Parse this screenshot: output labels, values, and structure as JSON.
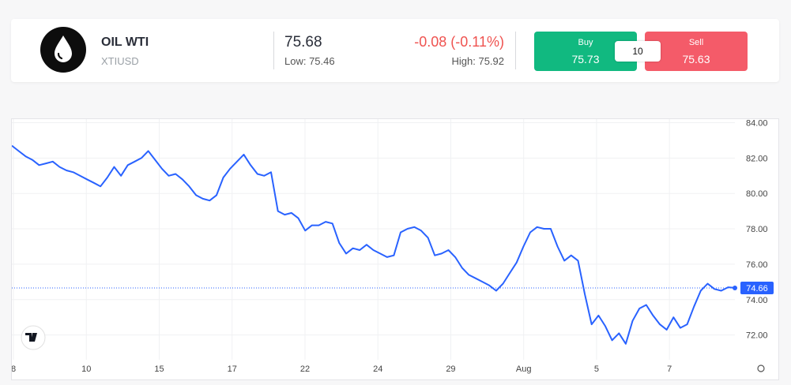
{
  "instrument": {
    "name": "OIL WTI",
    "symbol": "XTIUSD",
    "price": "75.68",
    "low_text": "Low: 75.46",
    "change_text": "-0.08 (-0.11%)",
    "high_text": "High: 75.92",
    "logo_icon": "oil-drop-icon"
  },
  "trade": {
    "buy_label": "Buy",
    "buy_price": "75.73",
    "sell_label": "Sell",
    "sell_price": "75.63",
    "quantity": "10"
  },
  "colors": {
    "buy": "#11b980",
    "sell": "#f45b69",
    "line": "#2962ff",
    "change_negative": "#ef5350"
  },
  "chart_data": {
    "type": "line",
    "title": "",
    "xlabel": "",
    "ylabel": "",
    "ylim": [
      70.6,
      84.2
    ],
    "x_ticks": [
      "8",
      "10",
      "15",
      "17",
      "22",
      "24",
      "29",
      "Aug",
      "5",
      "7"
    ],
    "y_ticks": [
      "84.00",
      "82.00",
      "80.00",
      "78.00",
      "76.00",
      "74.00",
      "72.00"
    ],
    "y_tick_values": [
      84,
      82,
      80,
      78,
      76,
      74,
      72
    ],
    "current_value": 74.66,
    "current_label": "74.66",
    "grid": true,
    "series": [
      {
        "name": "",
        "values": [
          82.7,
          82.4,
          82.1,
          81.9,
          81.6,
          81.7,
          81.8,
          81.5,
          81.3,
          81.2,
          81.0,
          80.8,
          80.6,
          80.4,
          80.9,
          81.5,
          81.0,
          81.6,
          81.8,
          82.0,
          82.4,
          81.9,
          81.4,
          81.0,
          81.1,
          80.8,
          80.4,
          79.9,
          79.7,
          79.6,
          79.9,
          80.9,
          81.4,
          81.8,
          82.2,
          81.6,
          81.1,
          81.0,
          81.2,
          79.0,
          78.8,
          78.9,
          78.6,
          77.9,
          78.2,
          78.2,
          78.4,
          78.3,
          77.2,
          76.6,
          76.9,
          76.8,
          77.1,
          76.8,
          76.6,
          76.4,
          76.5,
          77.8,
          78.0,
          78.1,
          77.9,
          77.5,
          76.5,
          76.6,
          76.8,
          76.4,
          75.8,
          75.4,
          75.2,
          75.0,
          74.8,
          74.5,
          74.9,
          75.5,
          76.1,
          77.0,
          77.8,
          78.1,
          78.0,
          78.0,
          77.0,
          76.2,
          76.5,
          76.2,
          74.3,
          72.6,
          73.1,
          72.5,
          71.7,
          72.1,
          71.5,
          72.8,
          73.5,
          73.7,
          73.1,
          72.6,
          72.3,
          73.0,
          72.4,
          72.6,
          73.6,
          74.5,
          74.9,
          74.6,
          74.5,
          74.7,
          74.66
        ]
      }
    ]
  }
}
